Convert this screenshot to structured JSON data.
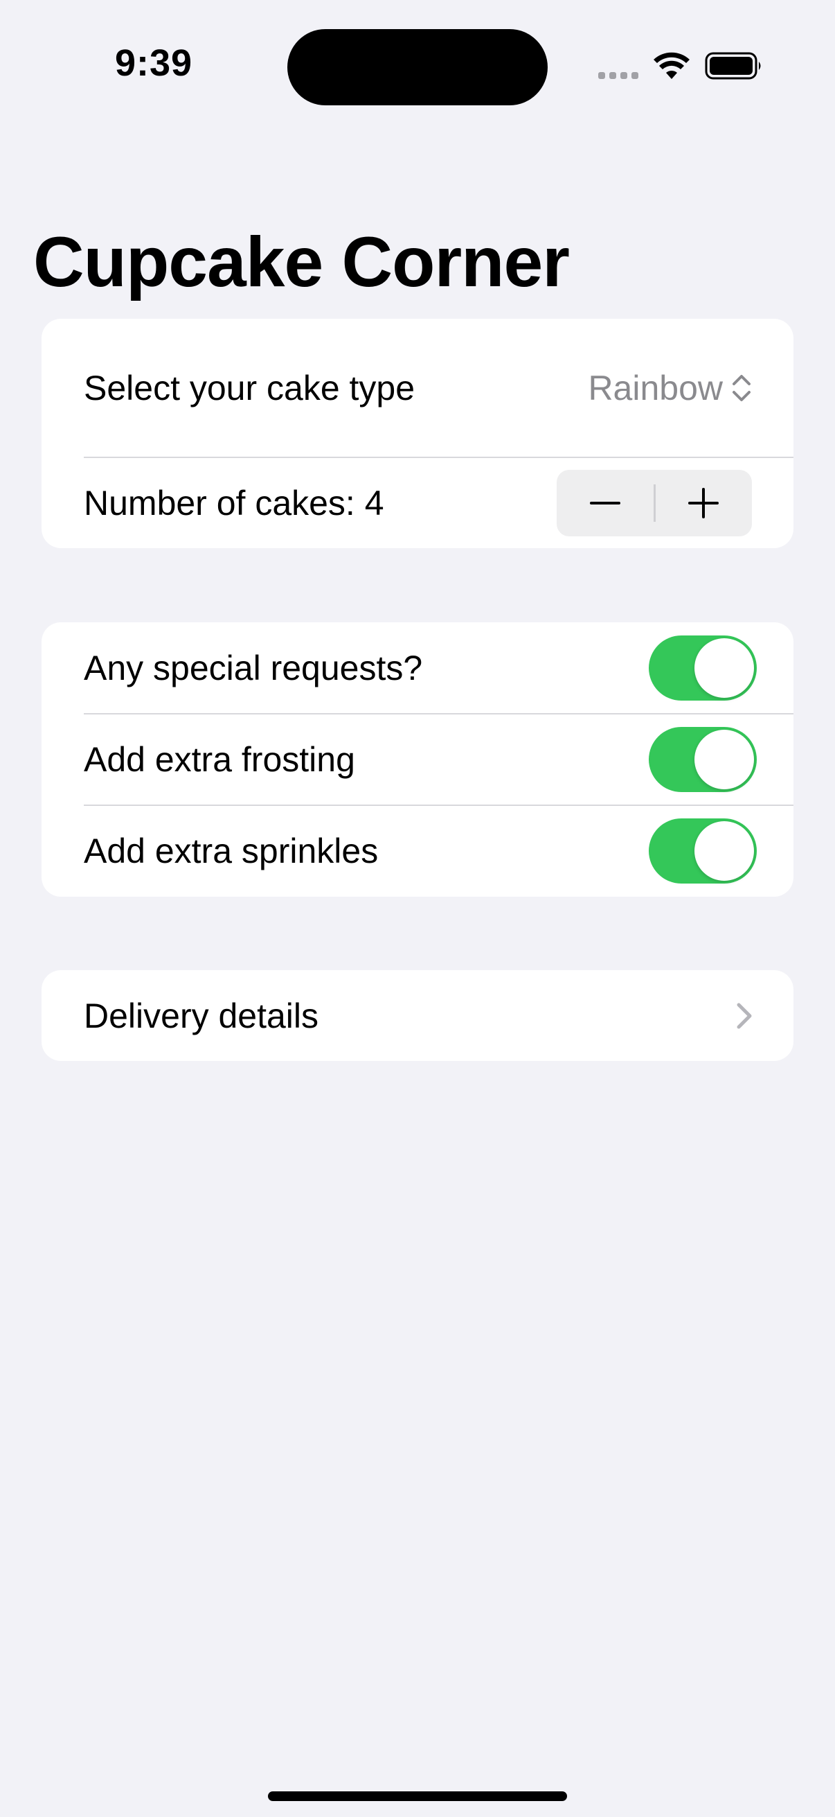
{
  "status_bar": {
    "time": "9:39"
  },
  "page": {
    "title": "Cupcake Corner"
  },
  "order_section": {
    "cake_type_label": "Select your cake type",
    "cake_type_value": "Rainbow",
    "quantity_label": "Number of cakes: 4",
    "quantity": 4,
    "decrement_icon": "minus-icon",
    "increment_icon": "plus-icon"
  },
  "special_section": {
    "toggles": [
      {
        "label": "Any special requests?",
        "on": true
      },
      {
        "label": "Add extra frosting",
        "on": true
      },
      {
        "label": "Add extra sprinkles",
        "on": true
      }
    ]
  },
  "delivery_section": {
    "label": "Delivery details",
    "icon": "chevron-right-icon"
  },
  "colors": {
    "background": "#f2f2f7",
    "card": "#ffffff",
    "toggle_on": "#34c759",
    "secondary_text": "#8a8a8e"
  }
}
